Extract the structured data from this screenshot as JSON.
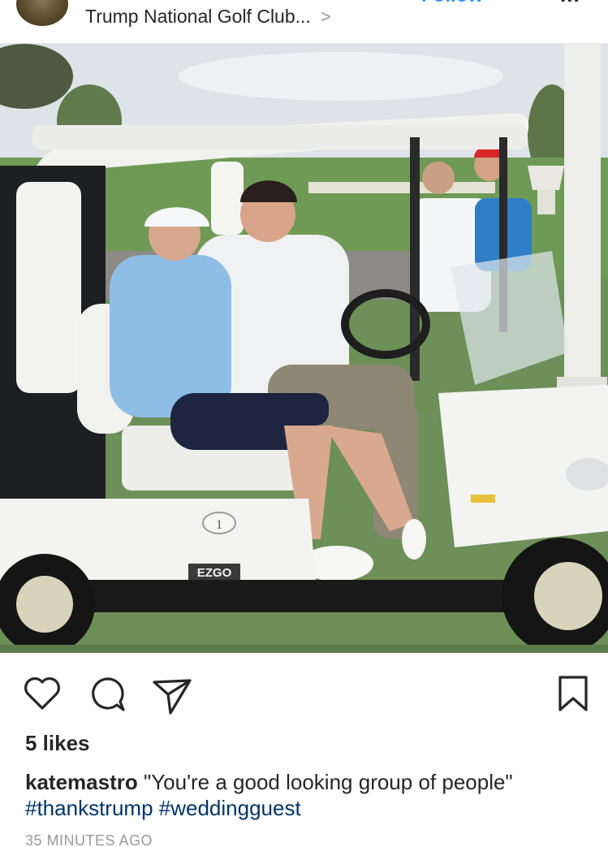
{
  "header": {
    "location_label": "Trump National Golf Club...",
    "chevron_glyph": ">",
    "follow_label": "Follow",
    "more_glyph": "..."
  },
  "photo": {
    "subject": "Two men seated in a white golf cart, two men standing behind, golf course and columns in background",
    "cart_number": "1",
    "cart_brand": "EZGO"
  },
  "actions": {
    "icons": [
      "heart-icon",
      "comment-icon",
      "share-icon",
      "bookmark-icon"
    ]
  },
  "post": {
    "likes": "5 likes",
    "username": "katemastro",
    "caption_text": " \"You're a good looking group of people\"",
    "hashtag_1": "#thankstrump",
    "hashtag_2": "#weddingguest",
    "timestamp": "35 MINUTES AGO"
  },
  "colors": {
    "link_blue": "#3897f0",
    "hashtag_navy": "#003569",
    "text": "#262626",
    "muted": "#999999"
  }
}
